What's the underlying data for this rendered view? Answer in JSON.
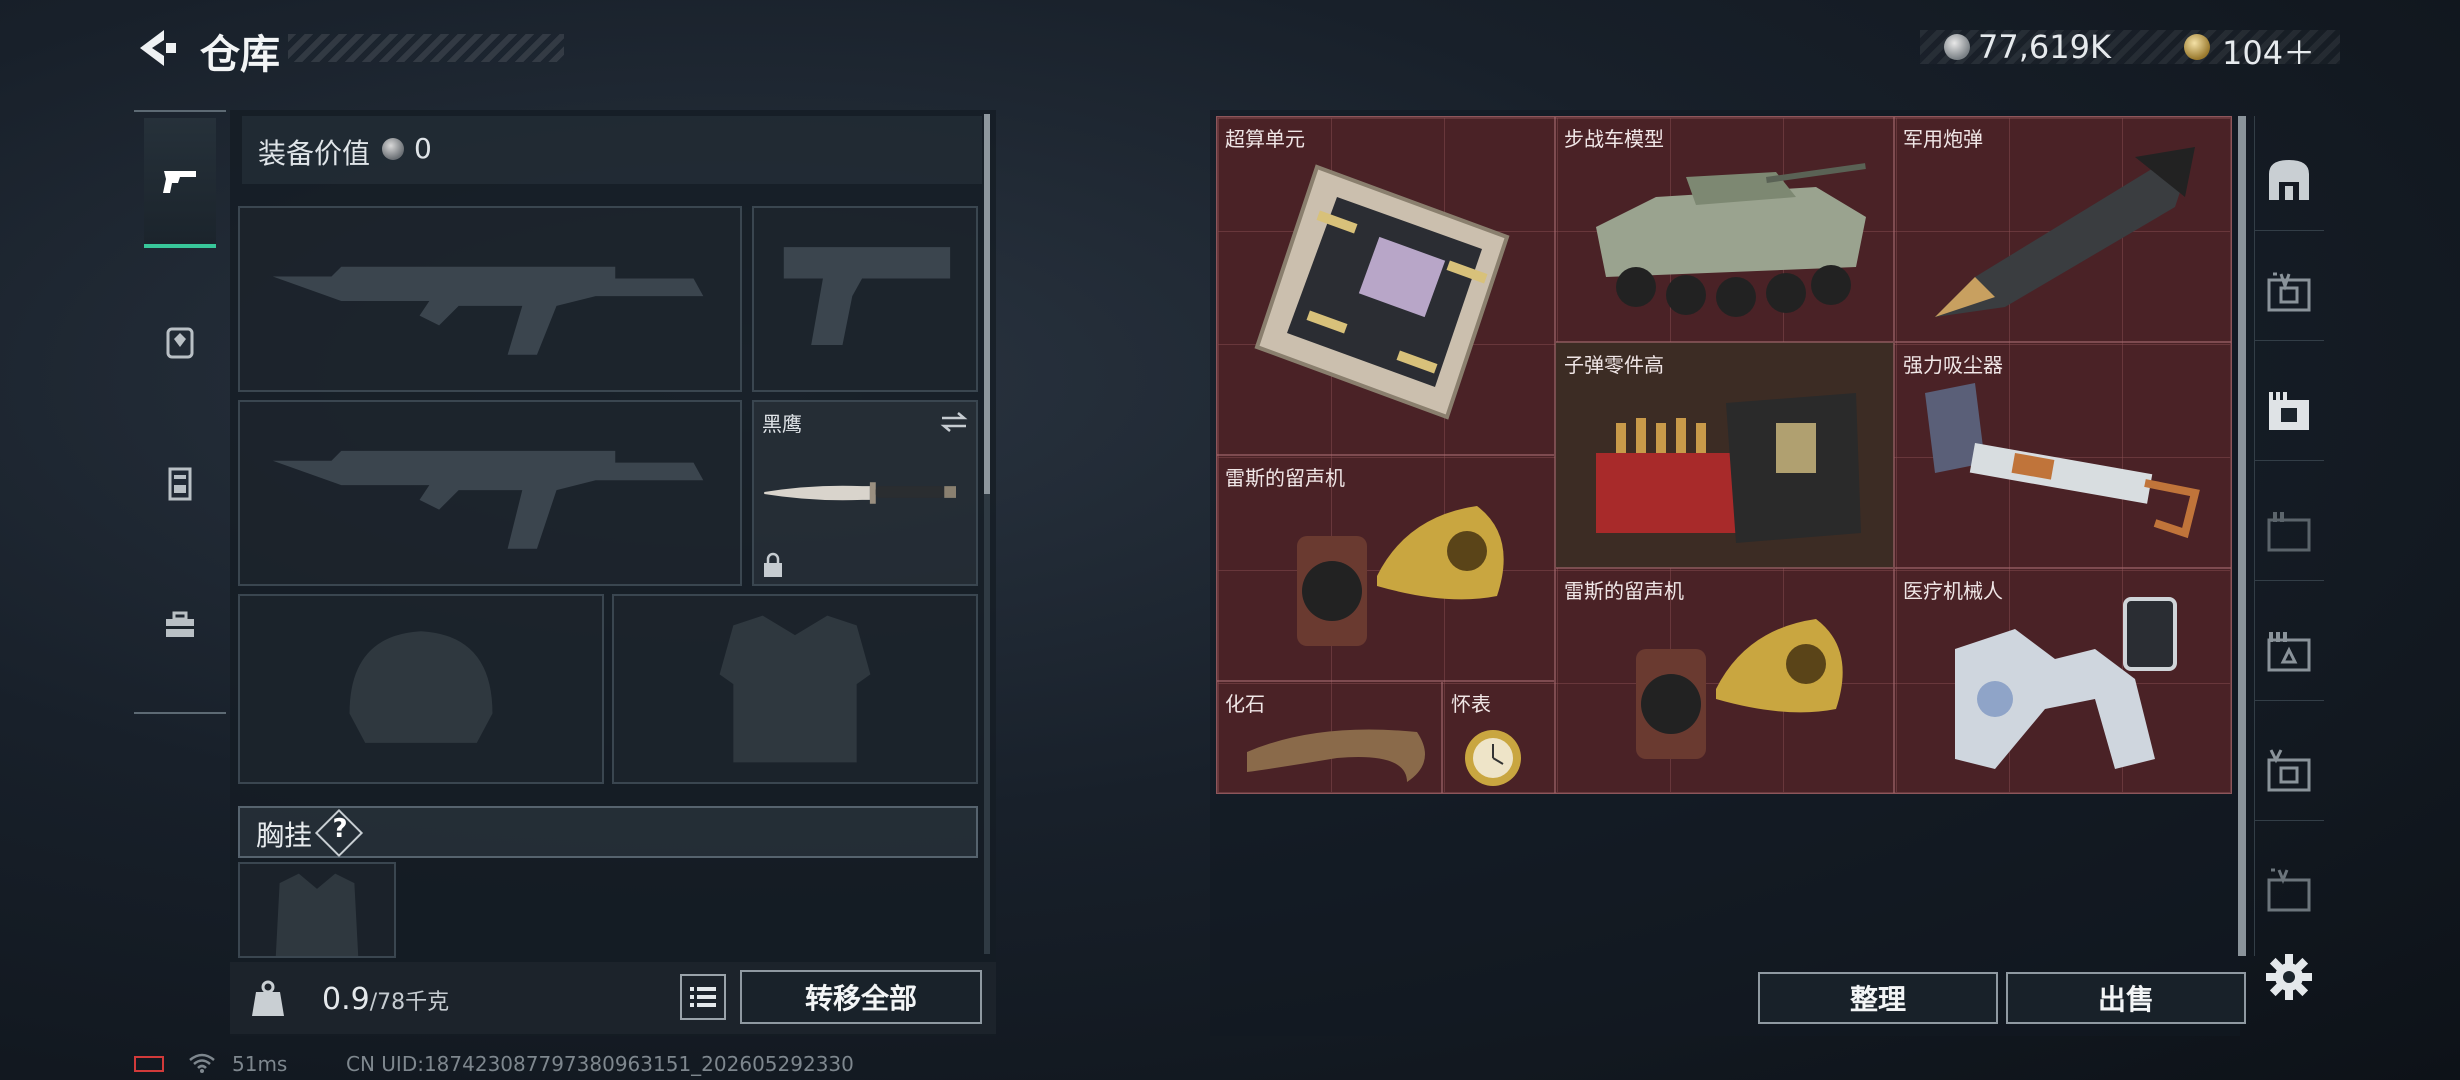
{
  "header": {
    "title": "仓库"
  },
  "currency": {
    "silver": "77,619K",
    "gold": "104＋"
  },
  "tabs": [
    "pistol",
    "backpack",
    "vest",
    "toolbox"
  ],
  "loadout": {
    "value_label": "装备价值",
    "value": "0",
    "knife_label": "黑鹰",
    "chest_label": "胸挂",
    "help": "?"
  },
  "footer_left": {
    "weight_value": "0.9",
    "weight_max": "/78千克",
    "transfer_all": "转移全部"
  },
  "storage_items": [
    {
      "label": "超算单元"
    },
    {
      "label": "步战车模型"
    },
    {
      "label": "军用炮弹"
    },
    {
      "label": "子弹零件高"
    },
    {
      "label": "强力吸尘器"
    },
    {
      "label": "雷斯的留声机"
    },
    {
      "label": "雷斯的留声机"
    },
    {
      "label": "医疗机械人"
    },
    {
      "label": "化石"
    },
    {
      "label": "怀表"
    }
  ],
  "actions": {
    "sort": "整理",
    "sell": "出售"
  },
  "status": {
    "ping": "51ms",
    "uid": "CN UID:187423087797380963151_202605292330"
  },
  "colors": {
    "grid_bg": "#4a2226",
    "accent": "#38c79a"
  }
}
